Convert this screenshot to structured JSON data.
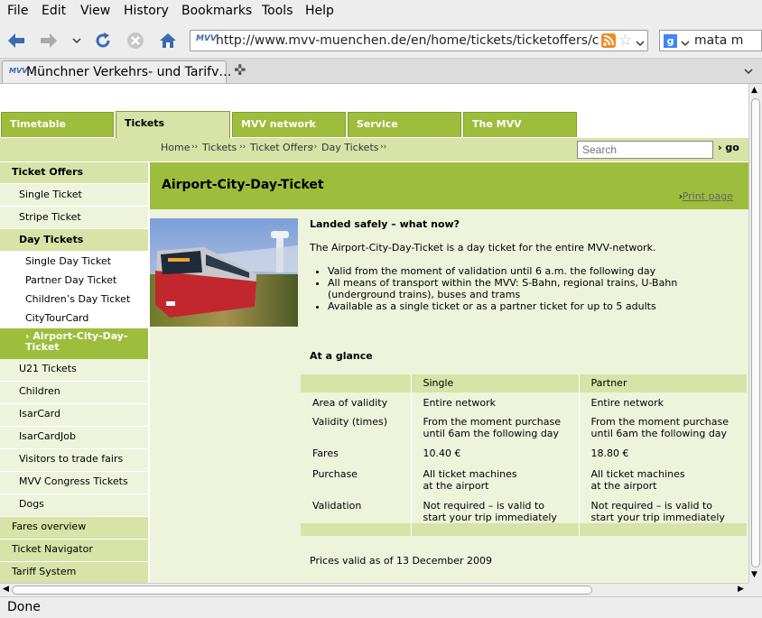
{
  "menubar": [
    "File",
    "Edit",
    "View",
    "History",
    "Bookmarks",
    "Tools",
    "Help"
  ],
  "url": "http://www.mvv-muenchen.de/en/home/tickets/ticketoffers/c",
  "search_engine_text": "mata m",
  "tab_title": "Münchner Verkehrs- und Tarifv…",
  "status": "Done",
  "colors": {
    "green": "#9ebd3c",
    "light_green": "#d7e3a7",
    "pale_green": "#eef3dc"
  },
  "site_tabs": [
    "Timetable",
    "Tickets",
    "MVV network",
    "Service",
    "The MVV"
  ],
  "breadcrumb": {
    "home": "Home",
    "sep": "››",
    "tickets": "Tickets",
    "offers": "Ticket Offers",
    "day": "Day Tickets",
    "end": "››"
  },
  "site_search": {
    "placeholder": "Search",
    "go": "› go"
  },
  "sidebar": {
    "ticket_offers": "Ticket Offers",
    "single": "Single Ticket",
    "stripe": "Stripe Ticket",
    "day": "Day Tickets",
    "single_day": "Single Day Ticket",
    "partner_day": "Partner Day Ticket",
    "children_day": "Children’s Day Ticket",
    "citytour": "CityTourCard",
    "airport": "› Airport-City-Day-Ticket",
    "u21": "U21 Tickets",
    "children": "Children",
    "isarcard": "IsarCard",
    "isarcardjob": "IsarCardJob",
    "visitors": "Visitors to trade fairs",
    "congress": "MVV Congress Tickets",
    "dogs": "Dogs",
    "fares_overview": "Fares overview",
    "navigator": "Ticket Navigator",
    "tariff": "Tariff System"
  },
  "main": {
    "title": "Airport-City-Day-Ticket",
    "print": "Print page",
    "print_arrow": "›",
    "heading": "Landed safely – what now?",
    "intro": "The Airport-City-Day-Ticket is a day ticket for the entire MVV-network.",
    "bullets": [
      "Valid from the moment of validation until 6 a.m. the following day",
      "All means of transport within the MVV: S-Bahn, regional trains, U-Bahn (underground trains), buses and trams",
      "Available as a single ticket or as a partner ticket for up to 5 adults"
    ],
    "glance": "At a glance",
    "table": {
      "headers": [
        "",
        "Single",
        "Partner"
      ],
      "rows": [
        [
          "Area of validity",
          "Entire network",
          "Entire network"
        ],
        [
          "Validity (times)",
          "From the moment purchase until 6am the following day",
          "From the moment purchase until 6am the following day"
        ],
        [
          "Fares",
          "10.40 €",
          "18.80 €"
        ],
        [
          "Purchase",
          "All ticket machines\nat the airport",
          "All ticket machines\nat the airport"
        ],
        [
          "Validation",
          "Not required – is valid to start your trip immediately",
          "Not required – is valid to start your trip immediately"
        ]
      ]
    },
    "prices_note": "Prices valid as of 13 December 2009"
  }
}
